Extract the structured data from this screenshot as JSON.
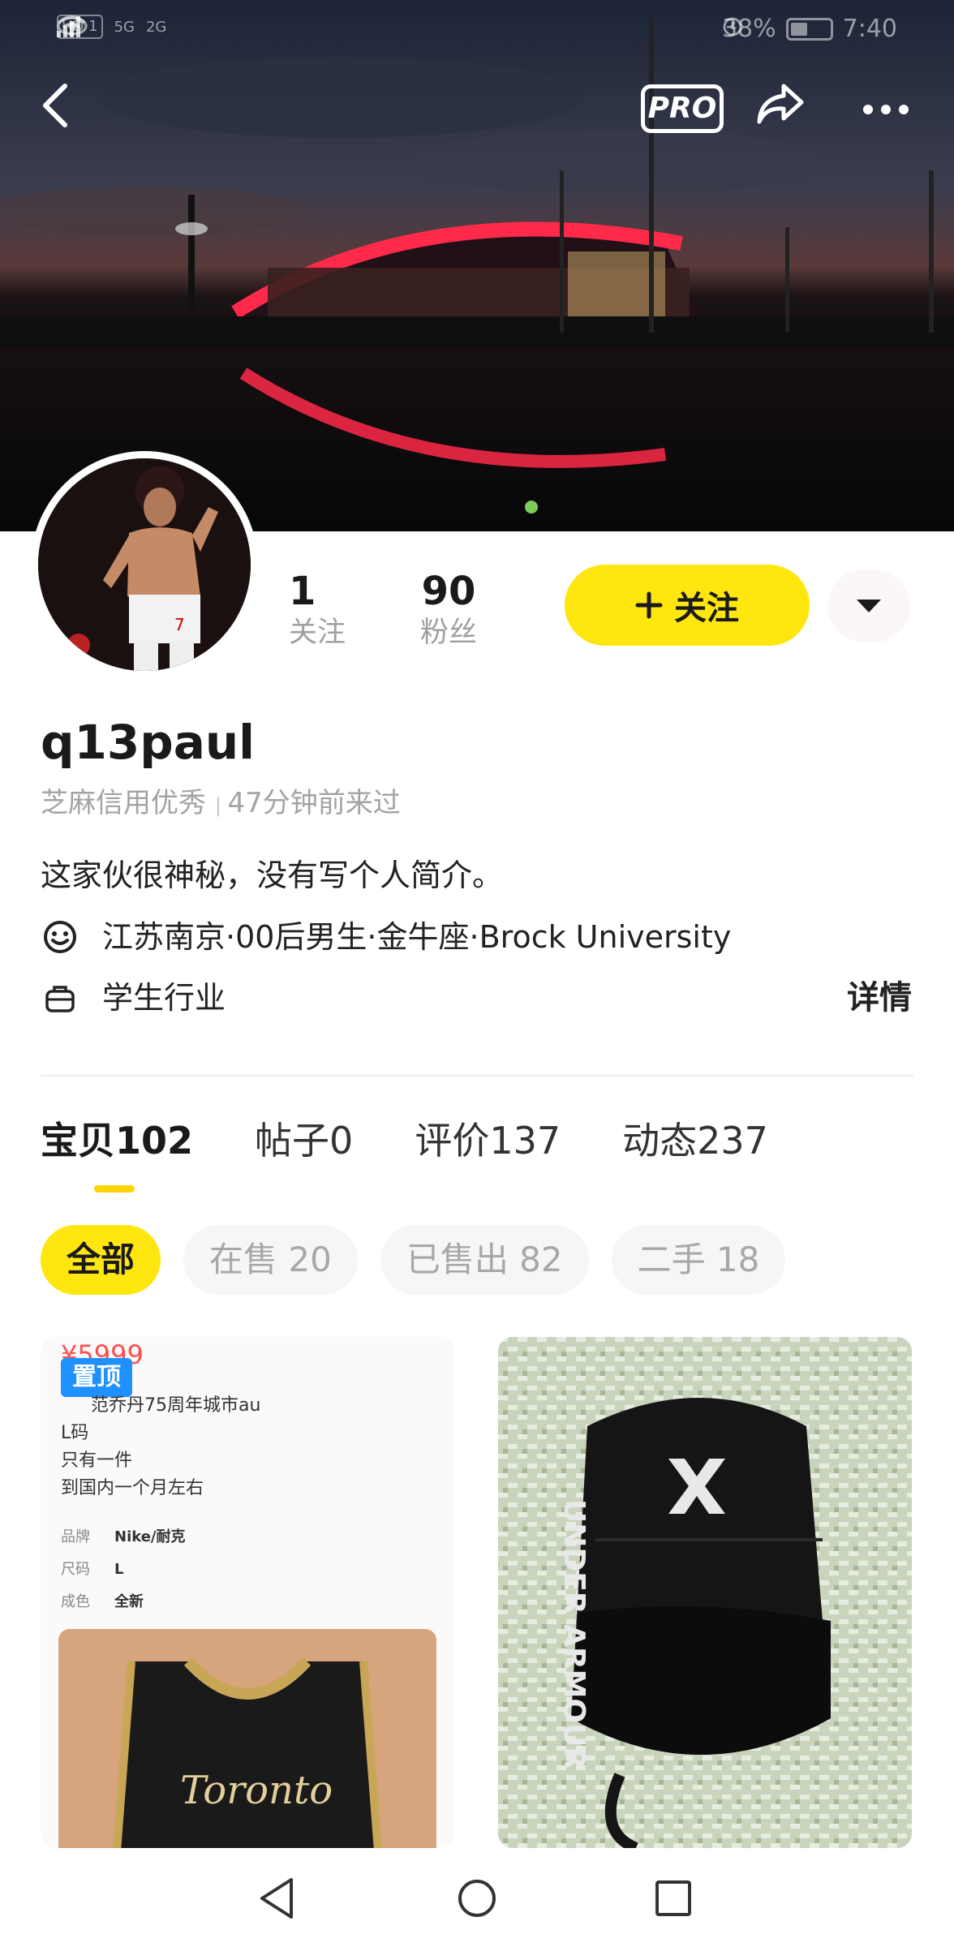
{
  "status_bar": {
    "left_chip": "HD 1",
    "signal_1": "5G",
    "signal_2": "2G",
    "battery": "38%",
    "time": "7:40"
  },
  "header": {
    "pro_label": "PRO",
    "back_icon": "chevron-left-icon",
    "share_icon": "share-icon",
    "more_icon": "more-dots-icon"
  },
  "profile": {
    "following_count": "1",
    "following_label": "关注",
    "followers_count": "90",
    "followers_label": "粉丝",
    "follow_button": "关注",
    "username": "q13paul",
    "credit": "芝麻信用优秀",
    "last_seen": "47分钟前来过",
    "bio": "这家伙很神秘，没有写个人简介。",
    "tags": "江苏南京·00后男生·金牛座·Brock University",
    "industry": "学生行业",
    "detail_link": "详情"
  },
  "tabs": [
    {
      "label": "宝贝",
      "count": "102"
    },
    {
      "label": "帖子",
      "count": "0"
    },
    {
      "label": "评价",
      "count": "137"
    },
    {
      "label": "动态",
      "count": "237"
    }
  ],
  "filters": [
    {
      "label": "全部"
    },
    {
      "label": "在售 20"
    },
    {
      "label": "已售出 82"
    },
    {
      "label": "二手 18"
    }
  ],
  "cards": {
    "left": {
      "pin_label": "置顶",
      "price": "¥5999",
      "line1": "范乔丹75周年城市au",
      "line2": "L码",
      "line3": "只有一件",
      "line4": "到国内一个月左右",
      "spec_brand_label": "品牌",
      "spec_brand_value": "Nike/耐克",
      "spec_size_label": "尺码",
      "spec_size_value": "L",
      "spec_cond_label": "成色",
      "spec_cond_value": "全新",
      "jersey_text": "Toronto"
    },
    "right": {
      "brand_text": "UNDER ARMOUR"
    }
  },
  "colors": {
    "accent_yellow": "#ffe60f",
    "pin_blue": "#1e90ff",
    "muted_text": "#a3a3a3"
  }
}
